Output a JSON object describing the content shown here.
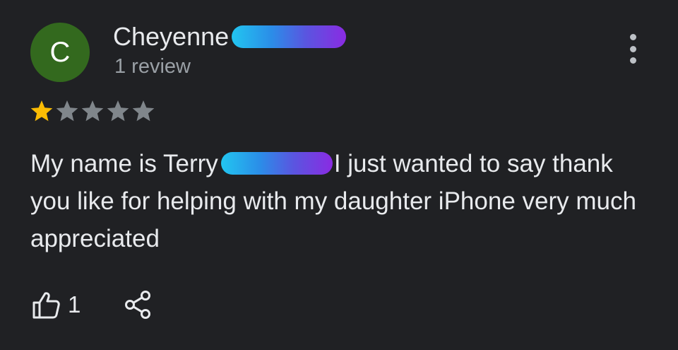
{
  "reviewer": {
    "avatar_letter": "C",
    "avatar_color": "#33691e",
    "name": "Cheyenne",
    "review_count": "1 review"
  },
  "rating": {
    "value": 1,
    "max": 5,
    "filled_color": "#fbbc04",
    "empty_color": "#80868b"
  },
  "review": {
    "text_before_redaction": "My name is Terry",
    "text_after_redaction": "I just wanted to say thank you like for helping with my daughter iPhone very much appreciated"
  },
  "actions": {
    "like_count": "1",
    "like_icon": "thumbs-up-icon",
    "share_icon": "share-icon",
    "more_icon": "more-vertical-icon"
  }
}
